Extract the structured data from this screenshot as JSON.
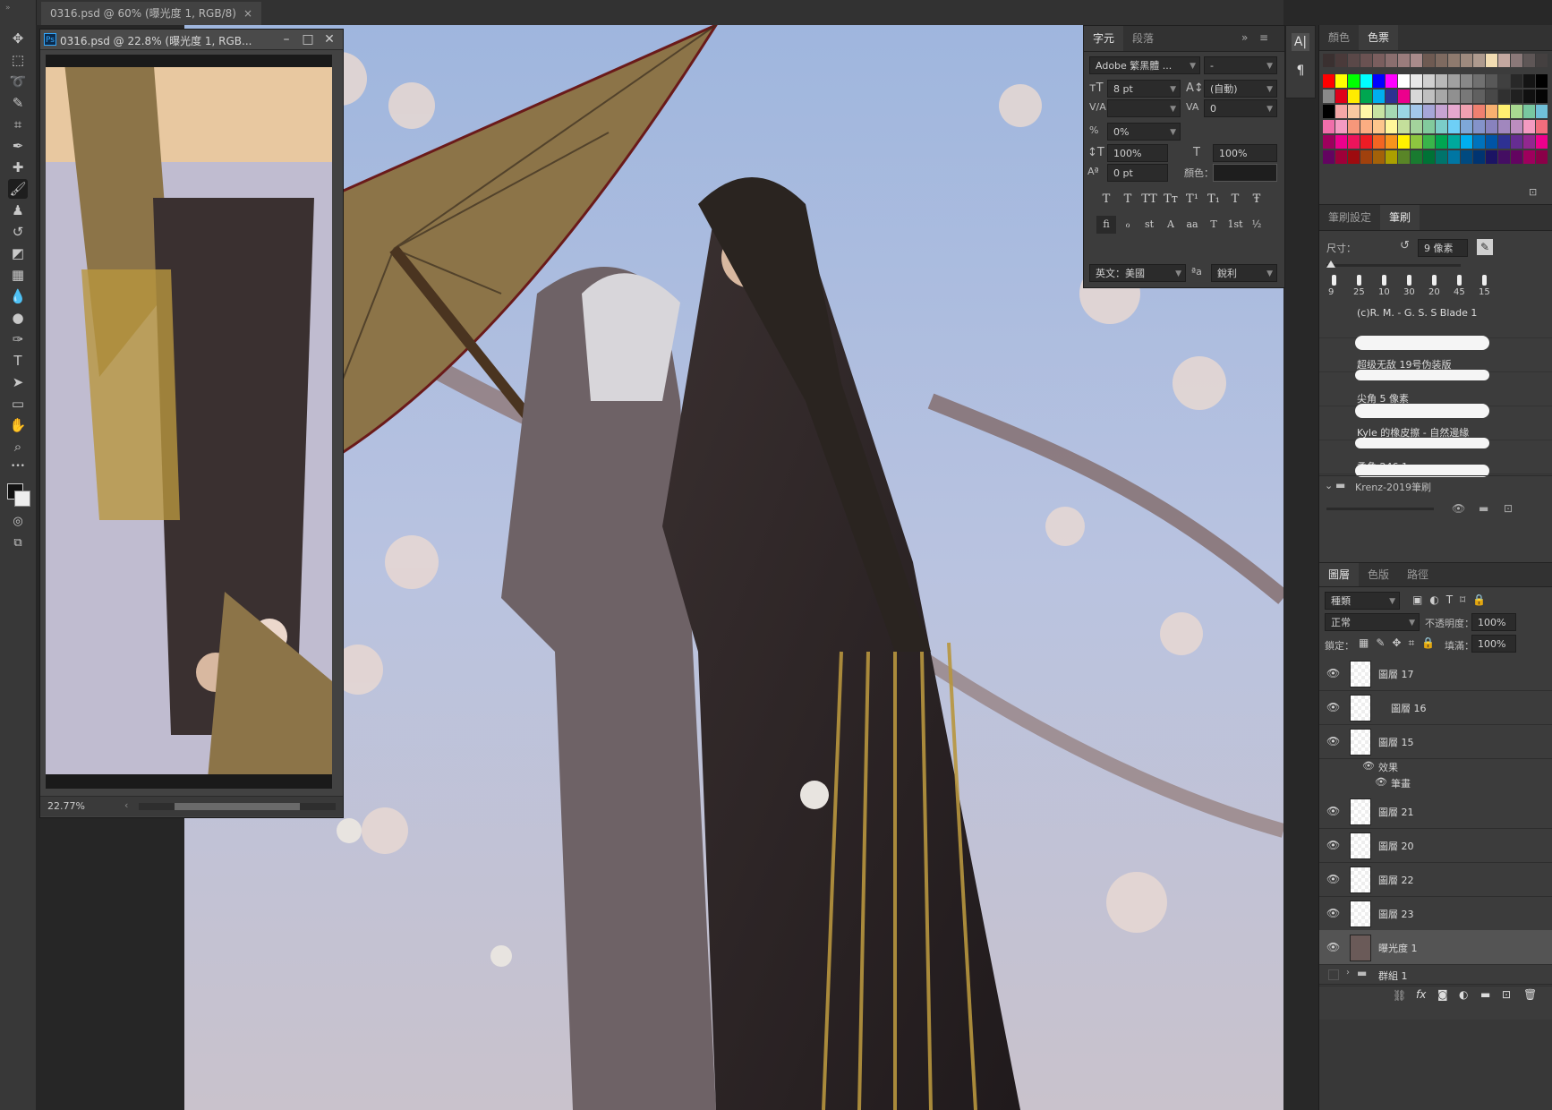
{
  "document": {
    "tab_title": "0316.psd @ 60% (曝光度 1, RGB/8)",
    "tab_close": "×"
  },
  "navigator": {
    "title": "0316.psd @ 22.8% (曝光度 1, RGB...",
    "app_badge": "Ps",
    "zoom": "22.77%",
    "min": "–",
    "max": "□",
    "close": "✕"
  },
  "tools": [
    {
      "name": "move-tool",
      "glyph": "✥"
    },
    {
      "name": "marquee-tool",
      "glyph": "⬚"
    },
    {
      "name": "lasso-tool",
      "glyph": "➰"
    },
    {
      "name": "quick-select-tool",
      "glyph": "✎"
    },
    {
      "name": "crop-tool",
      "glyph": "⌗"
    },
    {
      "name": "eyedropper-tool",
      "glyph": "✒"
    },
    {
      "name": "healing-tool",
      "glyph": "✚"
    },
    {
      "name": "brush-tool",
      "glyph": "🖌"
    },
    {
      "name": "stamp-tool",
      "glyph": "♟"
    },
    {
      "name": "history-brush-tool",
      "glyph": "↺"
    },
    {
      "name": "eraser-tool",
      "glyph": "◩"
    },
    {
      "name": "gradient-tool",
      "glyph": "▦"
    },
    {
      "name": "blur-tool",
      "glyph": "💧"
    },
    {
      "name": "dodge-tool",
      "glyph": "●"
    },
    {
      "name": "pen-tool",
      "glyph": "✑"
    },
    {
      "name": "type-tool",
      "glyph": "T"
    },
    {
      "name": "path-select-tool",
      "glyph": "➤"
    },
    {
      "name": "shape-tool",
      "glyph": "▭"
    },
    {
      "name": "hand-tool",
      "glyph": "✋"
    },
    {
      "name": "zoom-tool",
      "glyph": "⌕"
    },
    {
      "name": "more-tools",
      "glyph": "•••"
    }
  ],
  "character_panel": {
    "tabs": [
      "字元",
      "段落"
    ],
    "font_family": "Adobe 繁黑體 ...",
    "font_style": "-",
    "font_size": "8 pt",
    "leading": "(自動)",
    "kerning": "",
    "tracking": "0",
    "tsume": "0%",
    "vertical_scale": "100%",
    "horizontal_scale": "100%",
    "baseline_shift": "0 pt",
    "color_label": "顏色：",
    "format_buttons": [
      "T",
      "T",
      "TT",
      "Tт",
      "T¹",
      "T₁",
      "T",
      "Ŧ"
    ],
    "opentype_buttons": [
      "ﬁ",
      "ℴ",
      "st",
      "A",
      "aa",
      "T",
      "1st",
      "½"
    ],
    "language": "英文：美國",
    "aa_label": "ªa",
    "antialias": "銳利"
  },
  "swatches_panel": {
    "tabs": [
      "顏色",
      "色票"
    ],
    "colors": [
      "#3a3030",
      "#4a3a3a",
      "#5a4848",
      "#6a5252",
      "#7a5e5e",
      "#8a6e6e",
      "#9a7c7c",
      "#a88a8a",
      "#6e5a52",
      "#7e6a60",
      "#8e7a6e",
      "#9e8a7e",
      "#ae9a8e",
      "#f2dcb2",
      "#c4a8a0",
      "#8a7878",
      "#5e5656",
      "#444040",
      "#ff0000",
      "#ffff00",
      "#00ff00",
      "#00ffff",
      "#0000ff",
      "#ff00ff",
      "#ffffff",
      "#e8e8e8",
      "#d0d0d0",
      "#b8b8b8",
      "#a0a0a0",
      "#888888",
      "#707070",
      "#585858",
      "#404040",
      "#282828",
      "#141414",
      "#000000",
      "#8a8a8a",
      "#e0001a",
      "#ffec00",
      "#00a650",
      "#00aeef",
      "#2e3192",
      "#ec008c",
      "#d8d8d8",
      "#c0c0c0",
      "#a8a8a8",
      "#909090",
      "#787878",
      "#606060",
      "#484848",
      "#303030",
      "#202020",
      "#101010",
      "#050505",
      "#000000",
      "#f4a7a7",
      "#f9c8a0",
      "#fff7a8",
      "#c7e3a2",
      "#a5d8b3",
      "#9ad6e4",
      "#a3c7ea",
      "#a6a6d8",
      "#c6a3d3",
      "#e6a8cf",
      "#f0a0b0",
      "#f08070",
      "#f8b070",
      "#fff070",
      "#a8d890",
      "#78c8a0",
      "#70c0d8",
      "#f06eaa",
      "#f49ac2",
      "#f7977a",
      "#fbad82",
      "#fdc68c",
      "#fff79a",
      "#c4df9b",
      "#a3d39c",
      "#82ca9d",
      "#7bcdc8",
      "#6ecff6",
      "#7ea7d8",
      "#8493ca",
      "#8882be",
      "#a187be",
      "#bc8dbf",
      "#f49ac1",
      "#f26d7d",
      "#9e005d",
      "#ec008c",
      "#ed145b",
      "#ed1c24",
      "#f26522",
      "#f7941d",
      "#fff200",
      "#8dc63f",
      "#39b54a",
      "#00a651",
      "#00a99d",
      "#00aeef",
      "#0072bc",
      "#0054a6",
      "#2e3192",
      "#662d91",
      "#92278f",
      "#ec008c",
      "#630460",
      "#9e0039",
      "#9e0b0f",
      "#a0410d",
      "#a36209",
      "#aba000",
      "#598527",
      "#197b30",
      "#007236",
      "#00746b",
      "#0076a3",
      "#004a80",
      "#003471",
      "#1b1464",
      "#440e62",
      "#630460",
      "#9e005d",
      "#8a0048"
    ]
  },
  "brush_panel": {
    "tabs": [
      "筆刷設定",
      "筆刷"
    ],
    "size_label": "尺寸：",
    "size_value": "9 像素",
    "presets": [
      "9",
      "25",
      "10",
      "30",
      "20",
      "45",
      "15"
    ],
    "brushes": [
      "(c)R. M. - G. S. S Blade 1",
      "超级无敌 19号伪装版",
      "尖角 5 像素",
      "Kyle 的橡皮擦 - 自然邊緣",
      "柔角 246 1"
    ],
    "group": "Krenz-2019筆刷"
  },
  "layers_panel": {
    "tabs": [
      "圖層",
      "色版",
      "路徑"
    ],
    "filter": "種類",
    "blend_mode": "正常",
    "opacity_label": "不透明度：",
    "opacity": "100%",
    "lock_label": "鎖定：",
    "fill_label": "填滿：",
    "fill": "100%",
    "layers": [
      {
        "name": "圖層 17"
      },
      {
        "name": "圖層 16"
      },
      {
        "name": "圖層 15"
      },
      {
        "name": "圖層 21"
      },
      {
        "name": "圖層 20"
      },
      {
        "name": "圖層 22"
      },
      {
        "name": "圖層 23"
      },
      {
        "name": "曝光度 1"
      }
    ],
    "effects_label": "效果",
    "stroke_label": "筆畫",
    "group_name": "群組 1",
    "fx_label": "fx"
  }
}
